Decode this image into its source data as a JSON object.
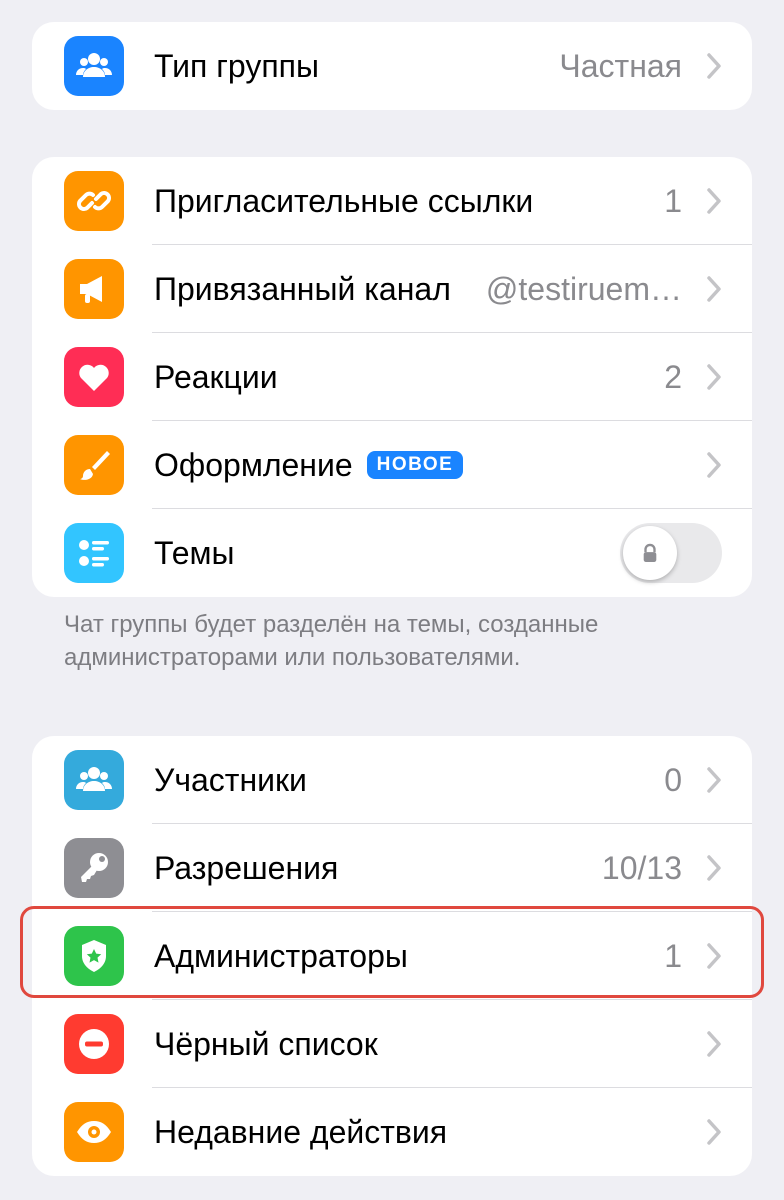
{
  "group_type": {
    "label": "Тип группы",
    "value": "Частная",
    "icon": "people-icon",
    "color": "#1a84ff"
  },
  "features": [
    {
      "label": "Пригласительные ссылки",
      "value": "1",
      "icon": "link-icon",
      "color": "#ff9500"
    },
    {
      "label": "Привязанный канал",
      "value": "@testiruem…",
      "icon": "megaphone-icon",
      "color": "#ff9500"
    },
    {
      "label": "Реакции",
      "value": "2",
      "icon": "heart-icon",
      "color": "#ff2d55"
    },
    {
      "label": "Оформление",
      "badge": "НОВОЕ",
      "icon": "brush-icon",
      "color": "#ff9500"
    },
    {
      "label": "Темы",
      "toggle_on": false,
      "toggle_locked": true,
      "icon": "topics-list-icon",
      "color": "#32c5ff"
    }
  ],
  "topics_footer": "Чат группы будет разделён на темы, созданные администраторами или пользователями.",
  "members": [
    {
      "label": "Участники",
      "value": "0",
      "icon": "people-icon",
      "color": "#34aadc"
    },
    {
      "label": "Разрешения",
      "value": "10/13",
      "icon": "key-icon",
      "color": "#8e8e93"
    },
    {
      "label": "Администраторы",
      "value": "1",
      "icon": "shield-star-icon",
      "color": "#2ec44b",
      "highlighted": true
    },
    {
      "label": "Чёрный список",
      "value": "",
      "icon": "block-icon",
      "color": "#ff3b30"
    },
    {
      "label": "Недавние действия",
      "value": "",
      "icon": "eye-icon",
      "color": "#ff9500"
    }
  ]
}
